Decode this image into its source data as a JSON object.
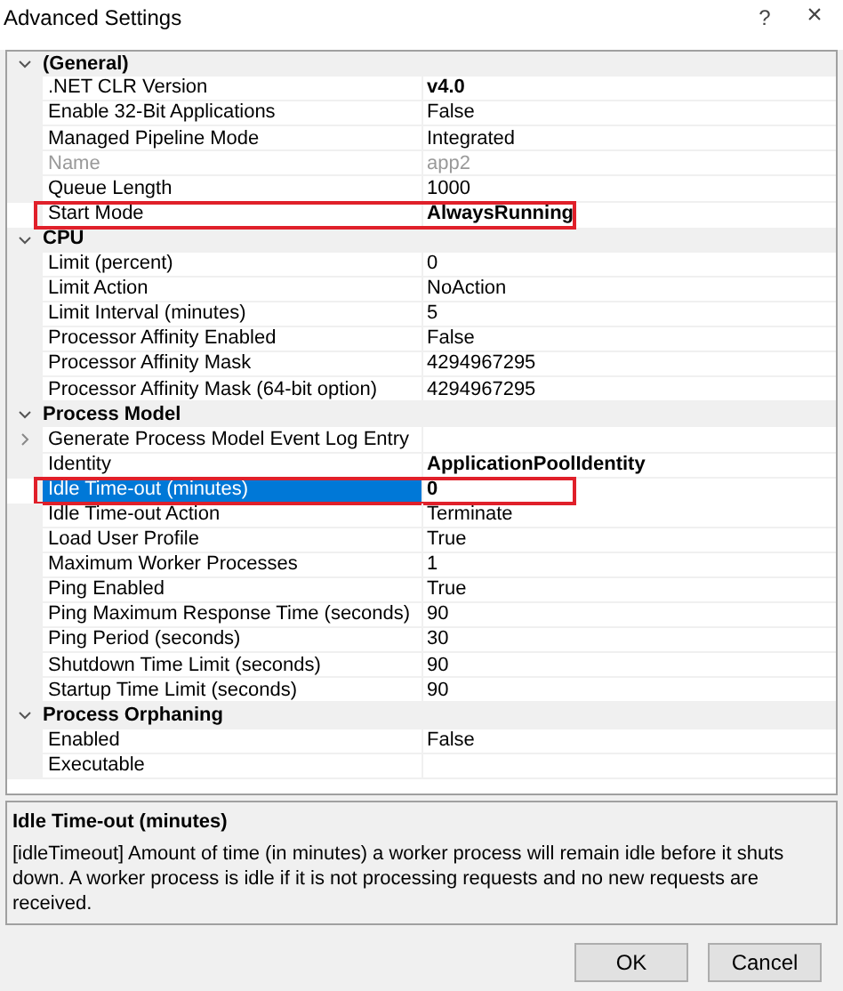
{
  "window": {
    "title": "Advanced Settings",
    "help": "?",
    "close": "×"
  },
  "grid": {
    "categories": [
      {
        "name": "(General)",
        "expanded": true,
        "properties": [
          {
            "name": ".NET CLR Version",
            "value": "v4.0",
            "modified": true,
            "disabled": false,
            "selected": false,
            "highlighted": false
          },
          {
            "name": "Enable 32-Bit Applications",
            "value": "False",
            "modified": false,
            "disabled": false,
            "selected": false,
            "highlighted": false
          },
          {
            "name": "Managed Pipeline Mode",
            "value": "Integrated",
            "modified": false,
            "disabled": false,
            "selected": false,
            "highlighted": false
          },
          {
            "name": "Name",
            "value": "app2",
            "modified": false,
            "disabled": true,
            "selected": false,
            "highlighted": false
          },
          {
            "name": "Queue Length",
            "value": "1000",
            "modified": false,
            "disabled": false,
            "selected": false,
            "highlighted": false
          },
          {
            "name": "Start Mode",
            "value": "AlwaysRunning",
            "modified": true,
            "disabled": false,
            "selected": false,
            "highlighted": true
          }
        ]
      },
      {
        "name": "CPU",
        "expanded": true,
        "properties": [
          {
            "name": "Limit (percent)",
            "value": "0",
            "modified": false,
            "disabled": false,
            "selected": false,
            "highlighted": false
          },
          {
            "name": "Limit Action",
            "value": "NoAction",
            "modified": false,
            "disabled": false,
            "selected": false,
            "highlighted": false
          },
          {
            "name": "Limit Interval (minutes)",
            "value": "5",
            "modified": false,
            "disabled": false,
            "selected": false,
            "highlighted": false
          },
          {
            "name": "Processor Affinity Enabled",
            "value": "False",
            "modified": false,
            "disabled": false,
            "selected": false,
            "highlighted": false
          },
          {
            "name": "Processor Affinity Mask",
            "value": "4294967295",
            "modified": false,
            "disabled": false,
            "selected": false,
            "highlighted": false
          },
          {
            "name": "Processor Affinity Mask (64-bit option)",
            "value": "4294967295",
            "modified": false,
            "disabled": false,
            "selected": false,
            "highlighted": false
          }
        ]
      },
      {
        "name": "Process Model",
        "expanded": true,
        "properties": [
          {
            "name": "Generate Process Model Event Log Entry",
            "expanded": false,
            "disabled": false,
            "selected": false,
            "highlighted": false
          },
          {
            "name": "Identity",
            "value": "ApplicationPoolIdentity",
            "modified": true,
            "disabled": false,
            "selected": false,
            "highlighted": false
          },
          {
            "name": "Idle Time-out (minutes)",
            "value": "0",
            "modified": true,
            "disabled": false,
            "selected": true,
            "highlighted": true
          },
          {
            "name": "Idle Time-out Action",
            "value": "Terminate",
            "modified": false,
            "disabled": false,
            "selected": false,
            "highlighted": false
          },
          {
            "name": "Load User Profile",
            "value": "True",
            "modified": false,
            "disabled": false,
            "selected": false,
            "highlighted": false
          },
          {
            "name": "Maximum Worker Processes",
            "value": "1",
            "modified": false,
            "disabled": false,
            "selected": false,
            "highlighted": false
          },
          {
            "name": "Ping Enabled",
            "value": "True",
            "modified": false,
            "disabled": false,
            "selected": false,
            "highlighted": false
          },
          {
            "name": "Ping Maximum Response Time (seconds)",
            "value": "90",
            "modified": false,
            "disabled": false,
            "selected": false,
            "highlighted": false
          },
          {
            "name": "Ping Period (seconds)",
            "value": "30",
            "modified": false,
            "disabled": false,
            "selected": false,
            "highlighted": false
          },
          {
            "name": "Shutdown Time Limit (seconds)",
            "value": "90",
            "modified": false,
            "disabled": false,
            "selected": false,
            "highlighted": false
          },
          {
            "name": "Startup Time Limit (seconds)",
            "value": "90",
            "modified": false,
            "disabled": false,
            "selected": false,
            "highlighted": false
          }
        ]
      },
      {
        "name": "Process Orphaning",
        "expanded": true,
        "properties": [
          {
            "name": "Enabled",
            "value": "False",
            "modified": false,
            "disabled": false,
            "selected": false,
            "highlighted": false
          },
          {
            "name": "Executable",
            "disabled": false,
            "selected": false,
            "highlighted": false
          }
        ]
      }
    ]
  },
  "description": {
    "title": "Idle Time-out (minutes)",
    "text": "[idleTimeout] Amount of time (in minutes) a worker process will remain idle before it shuts down. A worker process is idle if it is not processing requests and no new requests are received."
  },
  "buttons": [
    "OK",
    "Cancel"
  ]
}
